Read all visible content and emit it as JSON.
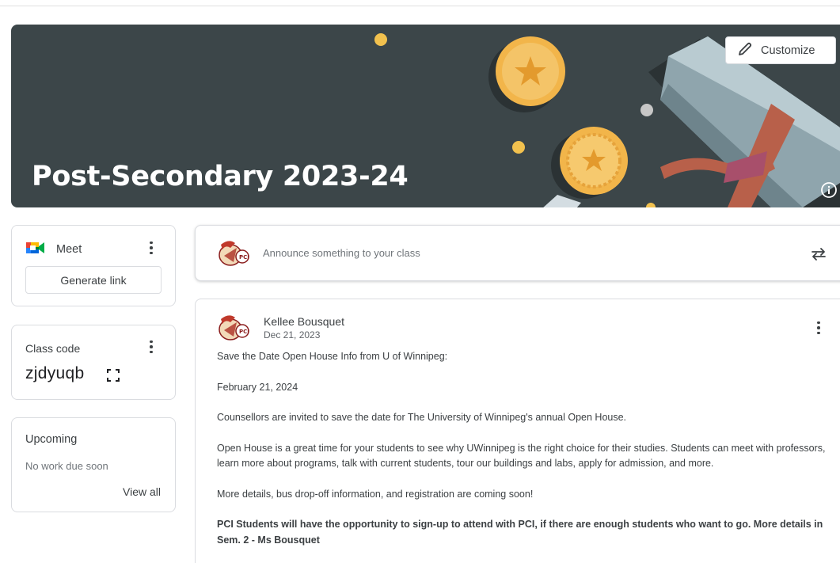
{
  "banner": {
    "title": "Post-Secondary 2023-24",
    "customize_label": "Customize"
  },
  "meet": {
    "label": "Meet",
    "generate_link_label": "Generate link"
  },
  "class_code": {
    "label": "Class code",
    "value": "zjdyuqb"
  },
  "upcoming": {
    "title": "Upcoming",
    "empty_text": "No work due soon",
    "view_all_label": "View all"
  },
  "announce": {
    "placeholder": "Announce something to your class"
  },
  "post": {
    "author": "Kellee Bousquet",
    "date": "Dec 21, 2023",
    "paragraphs": [
      "Save the Date Open House Info from U of Winnipeg:",
      "February 21, 2024",
      "Counsellors are invited to save the date for The University of Winnipeg's annual Open House.",
      "Open House is a great time for your students to see why UWinnipeg is the right choice for their studies. Students can meet with professors, learn more about programs, talk with current students, tour our buildings and labs, apply for admission, and more.",
      "More details, bus drop-off information, and registration are coming soon!",
      "PCI Students will have the opportunity to sign-up to attend with PCI, if there are enough students who want to go. More details in Sem. 2 - Ms Bousquet"
    ]
  },
  "icons": {
    "customize": "pencil-icon",
    "info": "info-icon",
    "meet": "meet-icon",
    "expand": "fullscreen-icon",
    "repost": "repost-icon",
    "more": "more-vert-icon"
  },
  "colors": {
    "banner_bg": "#3c4649",
    "coin": "#f2b54a",
    "ribbon": "#b8604a"
  }
}
